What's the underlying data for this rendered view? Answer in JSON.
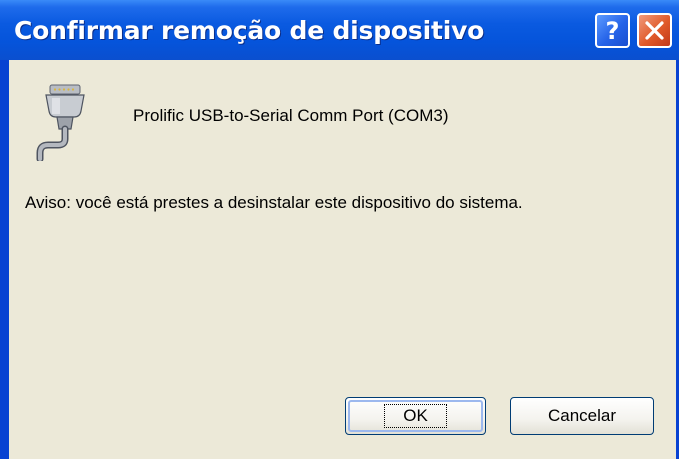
{
  "window": {
    "title": "Confirmar remoção de dispositivo",
    "help_label": "?",
    "colors": {
      "titlebar": "#0554DB",
      "client": "#ECE9D8",
      "close": "#E05A2A"
    }
  },
  "device": {
    "icon": "serial-port-cable-icon",
    "name": "Prolific USB-to-Serial Comm Port (COM3)"
  },
  "warning": {
    "text": "Aviso: você está prestes a desinstalar este dispositivo do sistema."
  },
  "buttons": {
    "ok_label": "OK",
    "cancel_label": "Cancelar"
  }
}
